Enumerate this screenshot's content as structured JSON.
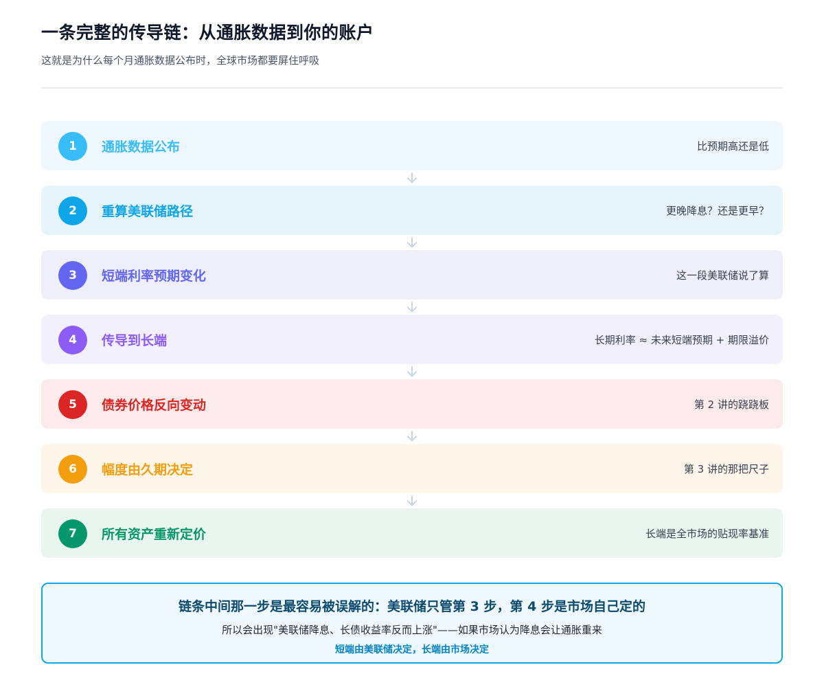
{
  "header": {
    "title": "一条完整的传导链：从通胀数据到你的账户",
    "subtitle": "这就是为什么每个月通胀数据公布时，全球市场都要屏住呼吸"
  },
  "steps": [
    {
      "num": "1",
      "title": "通胀数据公布",
      "note": "比预期高还是低",
      "color": "#38bdf8",
      "title_color": "#38bdf8",
      "bg": "#eef8fe"
    },
    {
      "num": "2",
      "title": "重算美联储路径",
      "note": "更晚降息？还是更早？",
      "color": "#0ea5e9",
      "title_color": "#0ea5e9",
      "bg": "#e7f4fb"
    },
    {
      "num": "3",
      "title": "短端利率预期变化",
      "note": "这一段美联储说了算",
      "color": "#6366f1",
      "title_color": "#6366f1",
      "bg": "#efeffb"
    },
    {
      "num": "4",
      "title": "传导到长端",
      "note": "长期利率 ≈ 未来短端预期 + 期限溢价",
      "color": "#8b5cf6",
      "title_color": "#8b5cf6",
      "bg": "#f3f0fd"
    },
    {
      "num": "5",
      "title": "债券价格反向变动",
      "note": "第 2 讲的跷跷板",
      "color": "#dc2626",
      "title_color": "#dc2626",
      "bg": "#fcebea"
    },
    {
      "num": "6",
      "title": "幅度由久期决定",
      "note": "第 3 讲的那把尺子",
      "color": "#f59e0b",
      "title_color": "#f59e0b",
      "bg": "#fef6ea"
    },
    {
      "num": "7",
      "title": "所有资产重新定价",
      "note": "长端是全市场的贴现率基准",
      "color": "#059669",
      "title_color": "#059669",
      "bg": "#e9f5ef"
    }
  ],
  "callout": {
    "headline": "链条中间那一步是最容易被误解的：美联储只管第 3 步，第 4 步是市场自己定的",
    "body": "所以会出现\"美联储降息、长债收益率反而上涨\"——如果市场认为降息会让通胀重来",
    "footer": "短端由美联储决定，长端由市场决定"
  },
  "icons": {
    "arrow": "arrow-down-icon"
  }
}
